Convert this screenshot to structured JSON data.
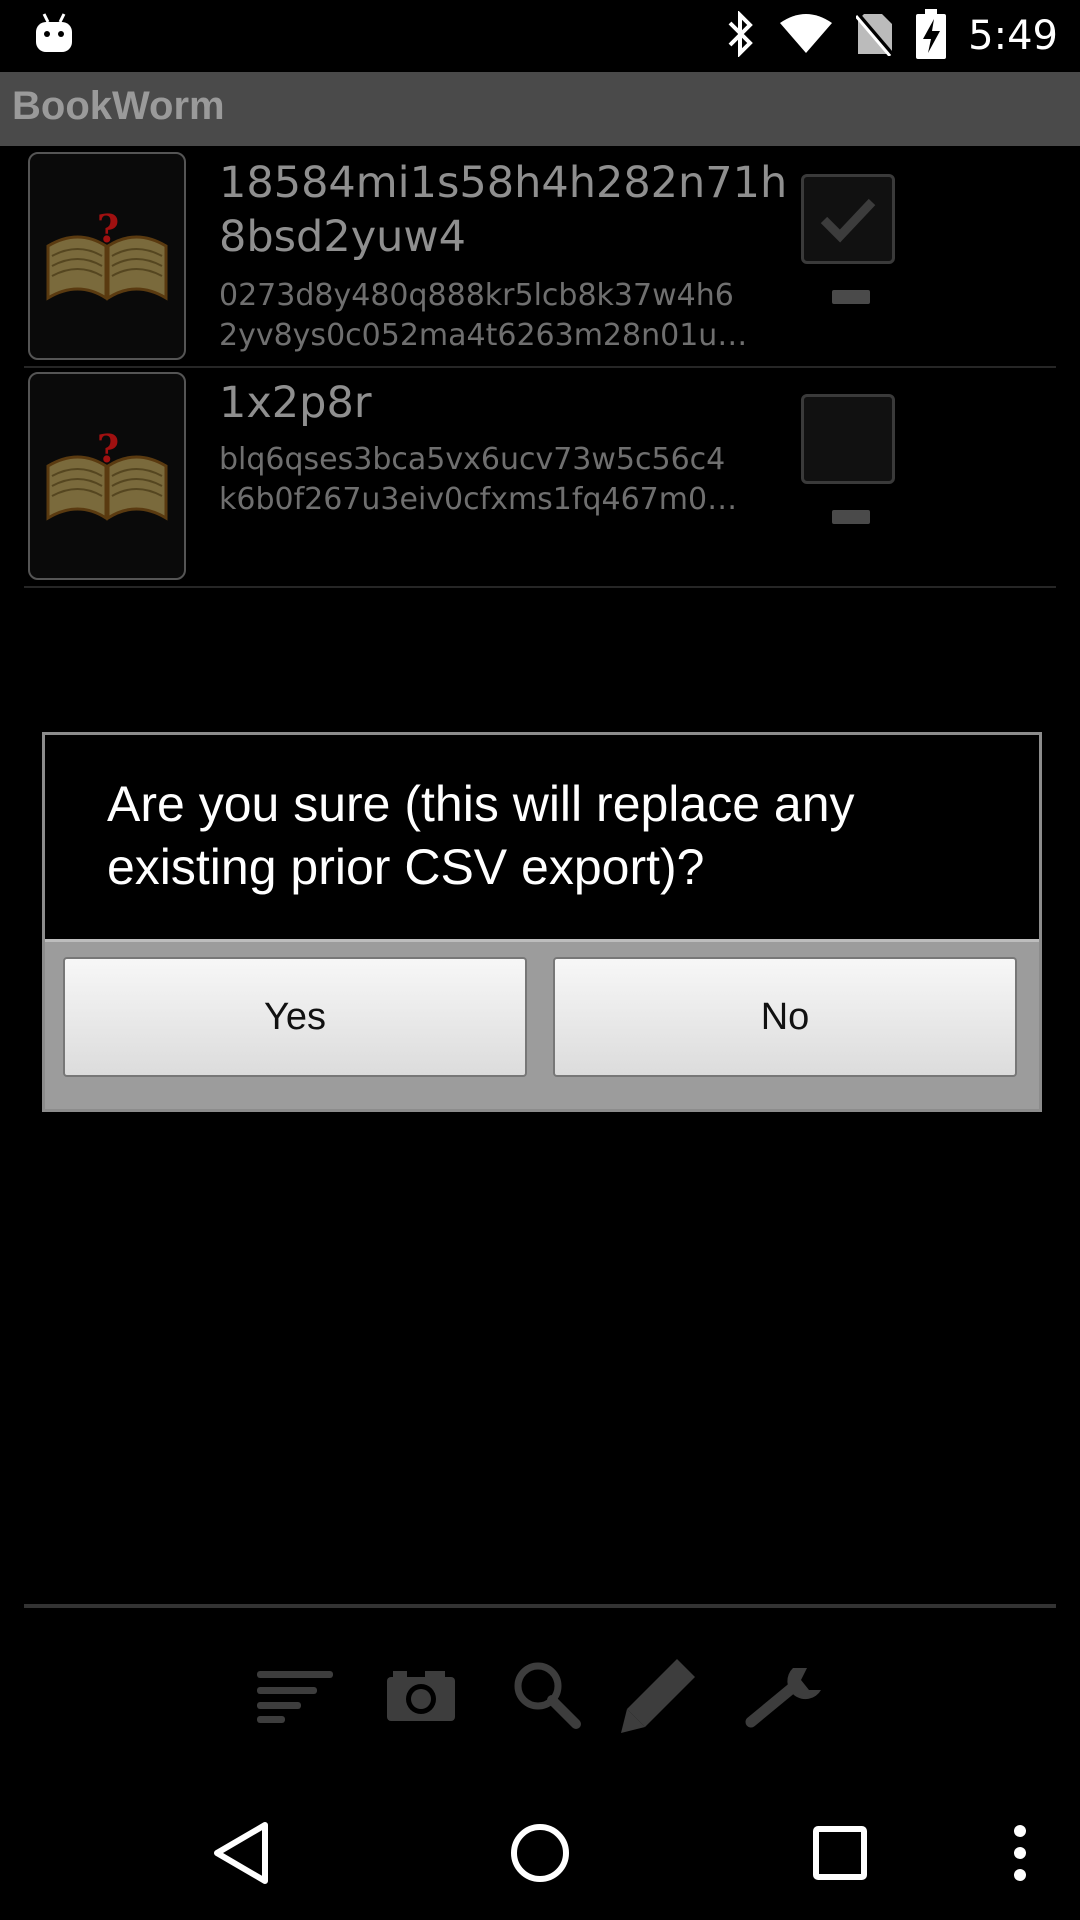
{
  "status_bar": {
    "time": "5:49",
    "icons": [
      "android-icon",
      "bluetooth-icon",
      "wifi-icon",
      "no-sim-icon",
      "battery-charging-icon"
    ]
  },
  "app": {
    "title": "BookWorm"
  },
  "books": [
    {
      "title": "18584mi1s58h4h282n71h8bsd2yuw4",
      "desc_line1": "0273d8y480q888kr5lcb8k37w4h6",
      "desc_line2": "2yv8ys0c052ma4t6263m28n01u…",
      "checked": true
    },
    {
      "title": "1x2p8r",
      "desc_line1": "blq6qses3bca5vx6ucv73w5c56c4",
      "desc_line2": "k6b0f267u3eiv0cfxms1fq467m0…",
      "checked": false
    }
  ],
  "dialog": {
    "message": "Are you sure (this will replace any existing prior CSV export)?",
    "yes_label": "Yes",
    "no_label": "No"
  },
  "toolbar": {
    "icons": [
      "sort-icon",
      "camera-icon",
      "search-icon",
      "edit-icon",
      "settings-wrench-icon"
    ]
  },
  "navigation": {
    "icons": [
      "back-icon",
      "home-icon",
      "recents-icon",
      "overflow-menu-icon"
    ]
  },
  "colors": {
    "background": "#000000",
    "appbar": "#4a4a4a",
    "dialog_border": "#8c8c8c",
    "button_bar": "#9c9c9c"
  }
}
